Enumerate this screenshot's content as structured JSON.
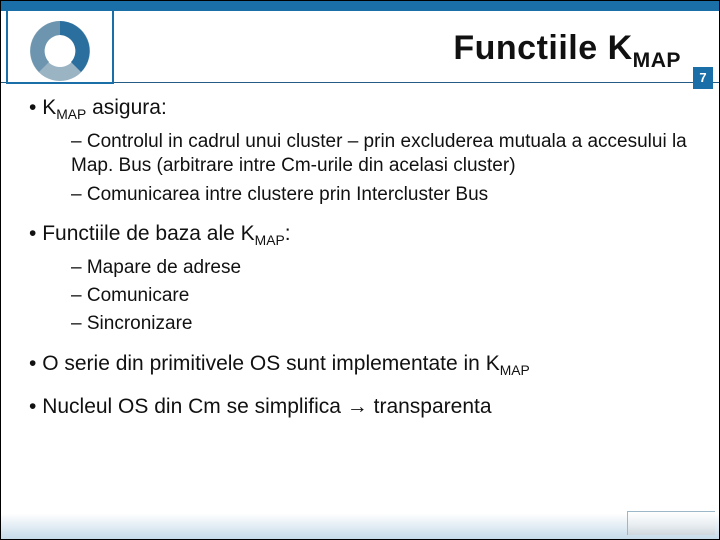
{
  "page_number": "7",
  "title_prefix": "Functiile K",
  "title_sub": "MAP",
  "bullets": [
    {
      "lead_pre": "K",
      "lead_sub": "MAP",
      "lead_post": " asigura:",
      "subs": [
        "Controlul in cadrul unui cluster – prin excluderea mutuala a accesului la Map. Bus (arbitrare intre Cm-urile din acelasi cluster)",
        "Comunicarea intre clustere prin Intercluster Bus"
      ]
    },
    {
      "lead_pre": "Functiile de baza ale K",
      "lead_sub": "MAP",
      "lead_post": ":",
      "subs": [
        "Mapare de adrese",
        "Comunicare",
        "Sincronizare"
      ]
    },
    {
      "lead_pre": "O serie din primitivele OS sunt implementate in K",
      "lead_sub": "MAP",
      "lead_post": "",
      "subs": []
    },
    {
      "lead_pre": "Nucleul OS din Cm se simplifica → transparenta",
      "lead_sub": "",
      "lead_post": "",
      "subs": []
    }
  ]
}
